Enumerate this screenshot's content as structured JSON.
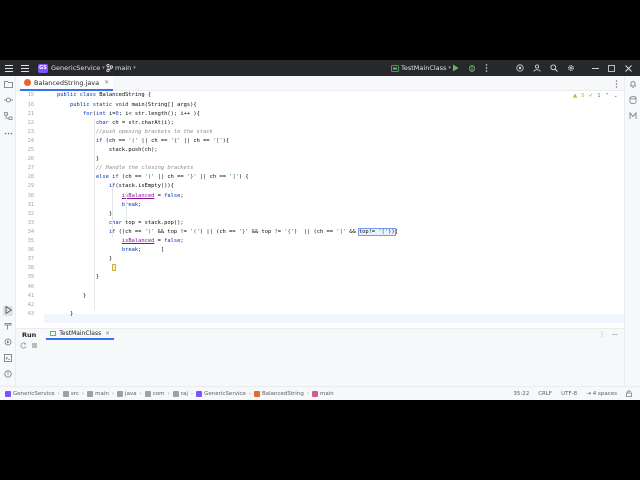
{
  "titlebar": {
    "project_badge": "GS",
    "project_name": "GenericService",
    "branch": "main",
    "run_config": "TestMainClass"
  },
  "tab": {
    "label": "BalancedString.java"
  },
  "inspections": {
    "warnings": "5",
    "ok": "1"
  },
  "editor": {
    "lines": [
      {
        "n": "15",
        "text": "    public class BalancedString {"
      },
      {
        "n": "16",
        "text": "        public static void main(String[] args){"
      },
      {
        "n": "21",
        "text": "            for(int i=0; i< str.length(); i++ ){"
      },
      {
        "n": "22",
        "text": "                char ch = str.charAt(i);"
      },
      {
        "n": "23",
        "text": "                //push opening brackets to the stack"
      },
      {
        "n": "24",
        "text": "                if (ch == '(' || ch == '{' || ch == '['){"
      },
      {
        "n": "25",
        "text": "                    stack.push(ch);"
      },
      {
        "n": "26",
        "text": "                }"
      },
      {
        "n": "27",
        "text": "                // Handle the closing brackets"
      },
      {
        "n": "28",
        "text": "                else if (ch == ')' || ch == '}' || ch == ']') {"
      },
      {
        "n": "29",
        "text": "                    if(stack.isEmpty()){"
      },
      {
        "n": "30",
        "text": "                        isBalanced = false;"
      },
      {
        "n": "31",
        "text": "                        break;"
      },
      {
        "n": "32",
        "text": "                    }"
      },
      {
        "n": "33",
        "text": "                    char top = stack.pop();"
      },
      {
        "n": "34",
        "text": "                    if ((ch == ')' && top != '(') || (ch == '}' && top != '{')  || (ch == ']' && top!= '[')){"
      },
      {
        "n": "35",
        "text": "                        isBalanced = false;"
      },
      {
        "n": "36",
        "text": "                        break;      ["
      },
      {
        "n": "37",
        "text": "                    }"
      },
      {
        "n": "38",
        "text": ""
      },
      {
        "n": "39",
        "text": "                }"
      },
      {
        "n": "40",
        "text": ""
      },
      {
        "n": "41",
        "text": "            }"
      },
      {
        "n": "42",
        "text": ""
      },
      {
        "n": "43",
        "text": "        }"
      }
    ]
  },
  "run": {
    "title": "Run",
    "tab_label": "TestMainClass"
  },
  "status": {
    "breadcrumbs": [
      "GenericService",
      "src",
      "main",
      "java",
      "com",
      "raj",
      "GenericService",
      "BalancedString",
      "main"
    ],
    "position": "35:22",
    "line_sep": "CRLF",
    "encoding": "UTF-8",
    "indent": "4 spaces"
  },
  "colors": {
    "accent": "#3574f0",
    "titlebar_bg": "#27282c",
    "project_badge": "#7f52ff",
    "keyword": "#0033b3",
    "string": "#067d17",
    "field": "#871094",
    "comment": "#8c8c8c"
  }
}
